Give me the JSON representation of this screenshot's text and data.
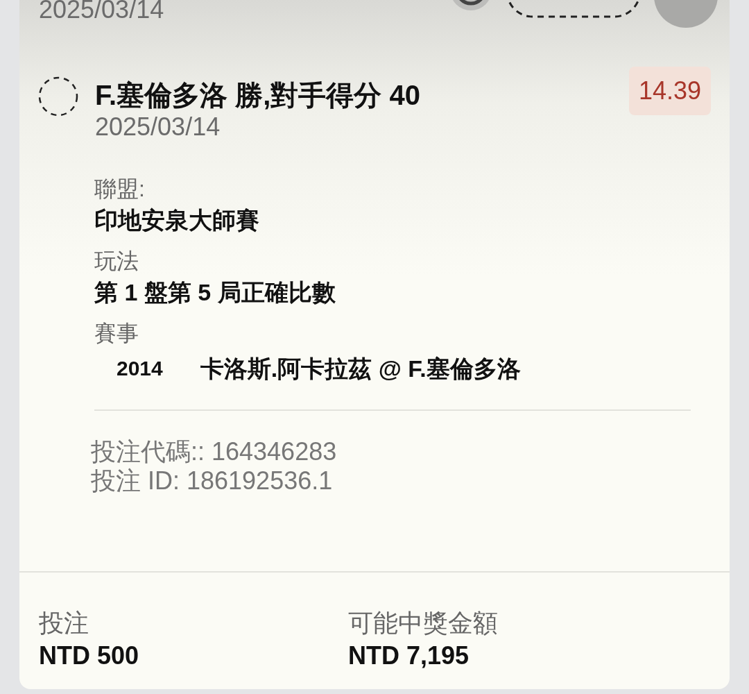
{
  "previous_bet": {
    "date": "2025/03/14"
  },
  "selection": {
    "selected": false,
    "title": "F.塞倫多洛 勝,對手得分 40",
    "date": "2025/03/14",
    "odds": "14.39"
  },
  "details": [
    {
      "label": "聯盟:",
      "value": "印地安泉大師賽"
    },
    {
      "label": "玩法",
      "value": "第 1 盤第 5 局正確比數"
    }
  ],
  "event": {
    "label": "賽事",
    "number": "2014",
    "teams": "卡洛斯.阿卡拉茲 @ F.塞倫多洛"
  },
  "codes": [
    "投注代碼:: 164346283",
    "投注 ID: 186192536.1"
  ],
  "summary": [
    {
      "label": "投注",
      "value": "NTD 500"
    },
    {
      "label": "可能中獎金額",
      "value": "NTD 7,195"
    }
  ]
}
